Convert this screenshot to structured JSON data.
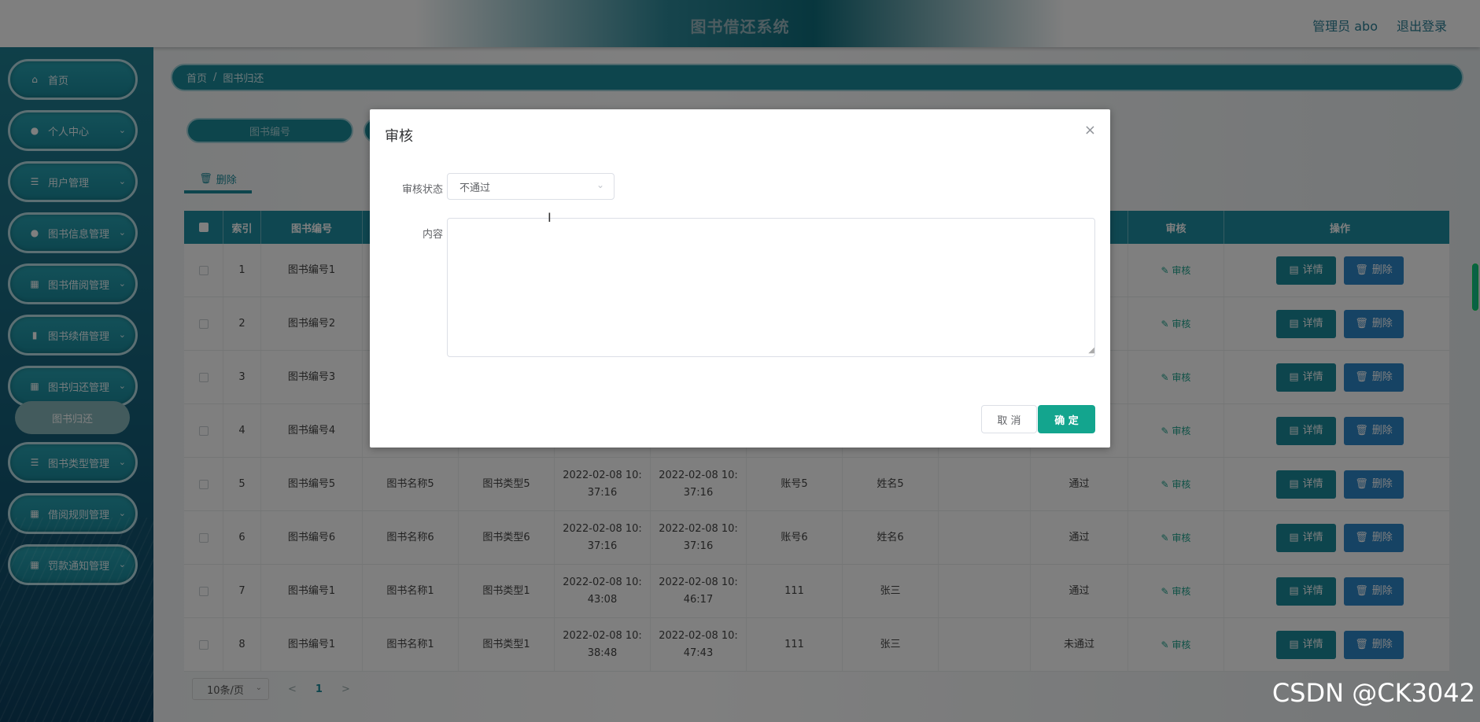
{
  "header": {
    "title": "图书借还系统",
    "user": "管理员 abo",
    "logout": "退出登录"
  },
  "sidebar": {
    "items": [
      {
        "label": "首页",
        "icon": "home-icon"
      },
      {
        "label": "个人中心",
        "icon": "user-icon"
      },
      {
        "label": "用户管理",
        "icon": "list-icon"
      },
      {
        "label": "图书信息管理",
        "icon": "bulb-icon"
      },
      {
        "label": "图书借阅管理",
        "icon": "grid-icon"
      },
      {
        "label": "图书续借管理",
        "icon": "chart-icon"
      },
      {
        "label": "图书归还管理",
        "icon": "grid-icon"
      },
      {
        "label": "图书类型管理",
        "icon": "list-icon"
      },
      {
        "label": "借阅规则管理",
        "icon": "grid-icon"
      },
      {
        "label": "罚款通知管理",
        "icon": "grid-icon"
      }
    ],
    "submenu_active": "图书归还"
  },
  "breadcrumb": {
    "home": "首页",
    "sep": "/",
    "current": "图书归还"
  },
  "search": {
    "placeholder": "图书编号"
  },
  "toolbar": {
    "delete_label": "删除",
    "delete_icon": "trash-icon"
  },
  "table": {
    "headers": {
      "index": "索引",
      "book_no": "图书编号",
      "audit": "审核",
      "action": "操作"
    },
    "audit_link": "审核",
    "detail_label": "详情",
    "delete_label": "删除",
    "rows": [
      {
        "index": "1",
        "book_no": "图书编号1",
        "name": "",
        "type": "",
        "t1a": "",
        "t1b": "",
        "t2a": "",
        "t2b": "",
        "acct": "",
        "person": "",
        "status": ""
      },
      {
        "index": "2",
        "book_no": "图书编号2",
        "name": "",
        "type": "",
        "t1a": "",
        "t1b": "",
        "t2a": "",
        "t2b": "",
        "acct": "",
        "person": "",
        "status": ""
      },
      {
        "index": "3",
        "book_no": "图书编号3",
        "name": "",
        "type": "",
        "t1a": "",
        "t1b": "",
        "t2a": "",
        "t2b": "",
        "acct": "",
        "person": "",
        "status": ""
      },
      {
        "index": "4",
        "book_no": "图书编号4",
        "name": "",
        "type": "",
        "t1a": "",
        "t1b": "",
        "t2a": "",
        "t2b": "",
        "acct": "",
        "person": "",
        "status": ""
      },
      {
        "index": "5",
        "book_no": "图书编号5",
        "name": "图书名称5",
        "type": "图书类型5",
        "t1a": "2022-02-08 10:",
        "t1b": "37:16",
        "t2a": "2022-02-08 10:",
        "t2b": "37:16",
        "acct": "账号5",
        "person": "姓名5",
        "status": "通过"
      },
      {
        "index": "6",
        "book_no": "图书编号6",
        "name": "图书名称6",
        "type": "图书类型6",
        "t1a": "2022-02-08 10:",
        "t1b": "37:16",
        "t2a": "2022-02-08 10:",
        "t2b": "37:16",
        "acct": "账号6",
        "person": "姓名6",
        "status": "通过"
      },
      {
        "index": "7",
        "book_no": "图书编号1",
        "name": "图书名称1",
        "type": "图书类型1",
        "t1a": "2022-02-08 10:",
        "t1b": "43:08",
        "t2a": "2022-02-08 10:",
        "t2b": "46:17",
        "acct": "111",
        "person": "张三",
        "status": "通过"
      },
      {
        "index": "8",
        "book_no": "图书编号1",
        "name": "图书名称1",
        "type": "图书类型1",
        "t1a": "2022-02-08 10:",
        "t1b": "38:48",
        "t2a": "2022-02-08 10:",
        "t2b": "47:43",
        "acct": "111",
        "person": "张三",
        "status": "未通过"
      }
    ]
  },
  "pagination": {
    "page_size": "10条/页",
    "prev": "<",
    "current_page": "1",
    "next": ">"
  },
  "modal": {
    "title": "审核",
    "close": "×",
    "status_label": "审核状态",
    "status_value": "不通过",
    "content_label": "内容",
    "content_value": "",
    "cancel_label": "取 消",
    "ok_label": "确 定"
  },
  "watermark": "CSDN @CK3042",
  "colors": {
    "primary": "#1a8a9a",
    "confirm": "#13a58e",
    "delete": "#2c86c8"
  }
}
